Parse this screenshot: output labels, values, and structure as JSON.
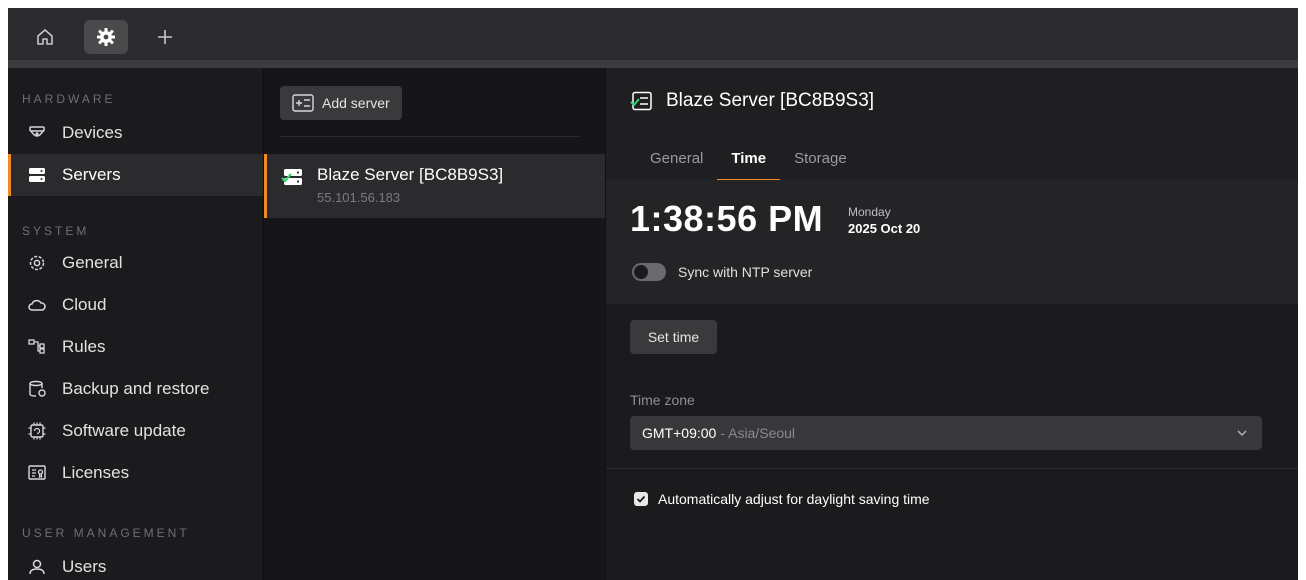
{
  "tabbar": {
    "tabs": [
      {
        "icon": "home-icon"
      },
      {
        "icon": "gear-icon"
      },
      {
        "icon": "plus-icon"
      }
    ]
  },
  "sidebar": {
    "sections": [
      {
        "label": "HARDWARE"
      },
      {
        "label": "SYSTEM"
      },
      {
        "label": "USER MANAGEMENT"
      }
    ],
    "items": [
      {
        "label": "Devices",
        "icon": "camera-icon"
      },
      {
        "label": "Servers",
        "icon": "server-icon",
        "active": true
      },
      {
        "label": "General",
        "icon": "gear-icon"
      },
      {
        "label": "Cloud",
        "icon": "cloud-icon"
      },
      {
        "label": "Rules",
        "icon": "rules-icon"
      },
      {
        "label": "Backup and restore",
        "icon": "database-restore-icon"
      },
      {
        "label": "Software update",
        "icon": "chip-update-icon"
      },
      {
        "label": "Licenses",
        "icon": "license-icon"
      },
      {
        "label": "Users",
        "icon": "user-icon"
      }
    ]
  },
  "serverlist": {
    "add_label": "Add server",
    "servers": [
      {
        "name": "Blaze Server [BC8B9S3]",
        "ip": "55.101.56.183"
      }
    ]
  },
  "detail": {
    "title": "Blaze Server [BC8B9S3]",
    "tabs": [
      "General",
      "Time",
      "Storage"
    ],
    "active_tab": "Time",
    "clock": {
      "time": "1:38:56 PM",
      "day": "Monday",
      "date": "2025 Oct 20"
    },
    "ntp_label": "Sync with NTP server",
    "ntp_enabled": false,
    "set_time_label": "Set time",
    "timezone_label": "Time zone",
    "timezone_value": "GMT+09:00",
    "timezone_region": "- Asia/Seoul",
    "dst_label": "Automatically adjust for daylight saving time",
    "dst_checked": true
  },
  "colors": {
    "accent": "#f08a24",
    "background": "#161618",
    "panel": "#1b1b1e"
  }
}
